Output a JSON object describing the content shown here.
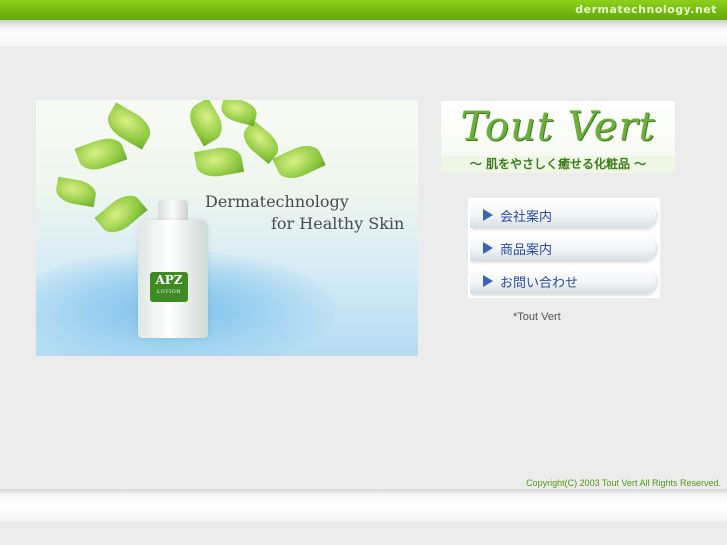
{
  "header": {
    "site_name": "dermatechnology.net",
    "accent_color": "#6cbc10"
  },
  "hero": {
    "tagline_line1": "Dermatechnology",
    "tagline_line2": "for  Healthy Skin",
    "bottle_label_brand": "APZ",
    "bottle_label_type": "LOTION"
  },
  "logo": {
    "title": "Tout Vert",
    "subtitle": "～ 肌をやさしく癒せる化粧品 ～"
  },
  "menu": {
    "items": [
      {
        "label": "会社案内",
        "icon": "triangle-right-icon"
      },
      {
        "label": "商品案内",
        "icon": "triangle-right-icon"
      },
      {
        "label": "お問い合わせ",
        "icon": "triangle-right-icon"
      }
    ]
  },
  "note": "*Tout Vert",
  "footer": {
    "copyright": "Copyright(C) 2003 Tout Vert All Rights Reserved."
  }
}
